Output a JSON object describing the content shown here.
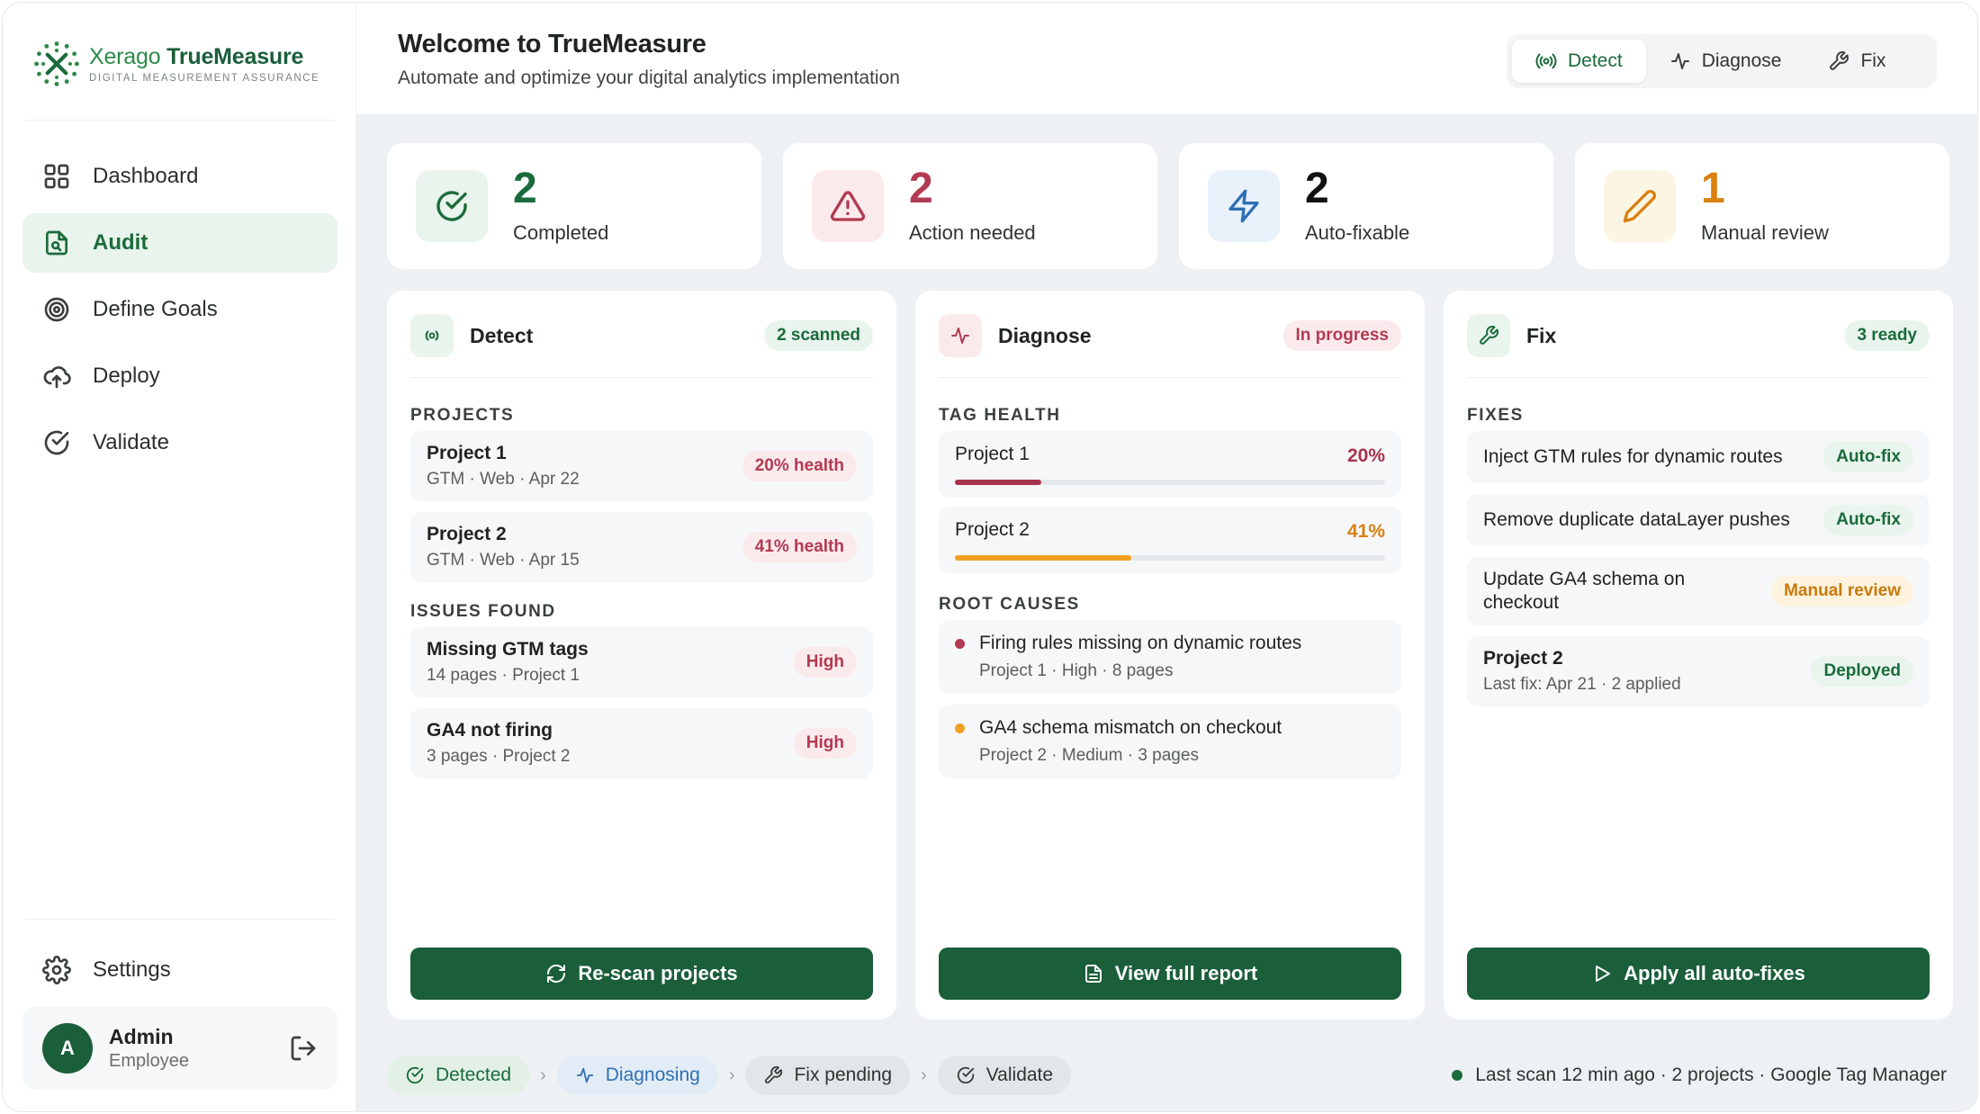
{
  "brand": {
    "name_part1": "Xerago",
    "name_part2": "TrueMeasure",
    "tagline": "DIGITAL MEASUREMENT ASSURANCE"
  },
  "nav": [
    {
      "label": "Dashboard",
      "icon": "grid-icon"
    },
    {
      "label": "Audit",
      "icon": "file-search-icon",
      "active": true
    },
    {
      "label": "Define Goals",
      "icon": "target-icon"
    },
    {
      "label": "Deploy",
      "icon": "cloud-upload-icon"
    },
    {
      "label": "Validate",
      "icon": "check-circle-icon"
    }
  ],
  "settings_label": "Settings",
  "user": {
    "initial": "A",
    "name": "Admin",
    "role": "Employee"
  },
  "header": {
    "title": "Welcome to TrueMeasure",
    "subtitle": "Automate and optimize your digital analytics implementation",
    "tabs": [
      "Detect",
      "Diagnose",
      "Fix"
    ],
    "active_tab": "Detect"
  },
  "stats": [
    {
      "value": "2",
      "label": "Completed",
      "color": "#1a6b3c"
    },
    {
      "value": "2",
      "label": "Action needed",
      "color": "#b23a52"
    },
    {
      "value": "2",
      "label": "Auto-fixable",
      "color": "#111111"
    },
    {
      "value": "1",
      "label": "Manual review",
      "color": "#d9800f"
    }
  ],
  "detect": {
    "title": "Detect",
    "pill": "2 scanned",
    "projects_heading": "PROJECTS",
    "projects": [
      {
        "name": "Project 1",
        "meta": "GTM · Web · Apr 22",
        "health": "20% health"
      },
      {
        "name": "Project 2",
        "meta": "GTM · Web · Apr 15",
        "health": "41% health"
      }
    ],
    "issues_heading": "ISSUES FOUND",
    "issues": [
      {
        "name": "Missing GTM tags",
        "meta": "14 pages · Project 1",
        "severity": "High"
      },
      {
        "name": "GA4 not firing",
        "meta": "3 pages · Project 2",
        "severity": "High"
      }
    ],
    "action": "Re-scan projects"
  },
  "diagnose": {
    "title": "Diagnose",
    "pill": "In progress",
    "health_heading": "TAG HEALTH",
    "health": [
      {
        "name": "Project 1",
        "pct_label": "20%",
        "value": 0.2,
        "color": "#a8324d"
      },
      {
        "name": "Project 2",
        "pct_label": "41%",
        "value": 0.41,
        "color": "#f0a020"
      }
    ],
    "causes_heading": "ROOT CAUSES",
    "causes": [
      {
        "title": "Firing rules missing on dynamic routes",
        "meta": "Project 1 · High · 8 pages",
        "color": "#b23a52"
      },
      {
        "title": "GA4 schema mismatch on checkout",
        "meta": "Project 2 · Medium · 3 pages",
        "color": "#f0a020"
      }
    ],
    "action": "View full report"
  },
  "fix": {
    "title": "Fix",
    "pill": "3 ready",
    "fixes_heading": "FIXES",
    "fixes": [
      {
        "title": "Inject GTM rules for dynamic routes",
        "sub": "",
        "badge": "Auto-fix",
        "type": "green"
      },
      {
        "title": "Remove duplicate dataLayer pushes",
        "sub": "",
        "badge": "Auto-fix",
        "type": "green"
      },
      {
        "title": "Update GA4 schema on checkout",
        "sub": "",
        "badge": "Manual review",
        "type": "orange"
      },
      {
        "title": "Project 2",
        "sub": "Last fix: Apr 21 · 2 applied",
        "badge": "Deployed",
        "type": "green"
      }
    ],
    "action": "Apply all auto-fixes"
  },
  "footer": {
    "steps": [
      {
        "label": "Detected",
        "state": "done"
      },
      {
        "label": "Diagnosing",
        "state": "current"
      },
      {
        "label": "Fix pending",
        "state": "pending"
      },
      {
        "label": "Validate",
        "state": "pending"
      }
    ],
    "status": "Last scan 12 min ago · 2 projects · Google Tag Manager"
  }
}
